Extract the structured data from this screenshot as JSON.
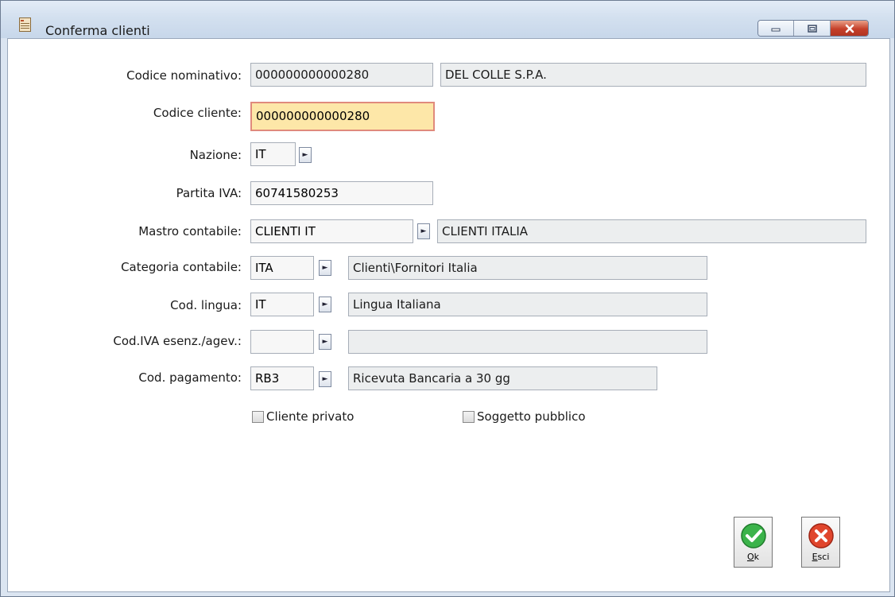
{
  "window": {
    "title": "Conferma clienti"
  },
  "form": {
    "codice_nominativo": {
      "label": "Codice nominativo:",
      "code": "000000000000280",
      "description": "DEL COLLE S.P.A."
    },
    "codice_cliente": {
      "label": "Codice cliente:",
      "value": "000000000000280"
    },
    "nazione": {
      "label": "Nazione:",
      "value": "IT"
    },
    "partita_iva": {
      "label": "Partita IVA:",
      "value": "60741580253"
    },
    "mastro_contabile": {
      "label": "Mastro contabile:",
      "code": "CLIENTI IT",
      "description": "CLIENTI ITALIA"
    },
    "categoria_contabile": {
      "label": "Categoria contabile:",
      "code": "ITA",
      "description": "Clienti\\Fornitori Italia"
    },
    "cod_lingua": {
      "label": "Cod. lingua:",
      "code": "IT",
      "description": "Lingua Italiana"
    },
    "cod_iva": {
      "label": "Cod.IVA esenz./agev.:",
      "code": "",
      "description": ""
    },
    "cod_pagamento": {
      "label": "Cod. pagamento:",
      "code": "RB3",
      "description": "Ricevuta Bancaria a 30 gg"
    },
    "cliente_privato": {
      "label": "Cliente privato",
      "checked": false
    },
    "soggetto_pubblico": {
      "label": "Soggetto pubblico",
      "checked": false
    }
  },
  "buttons": {
    "ok": {
      "label_mnemonic": "O",
      "label_rest": "k"
    },
    "esci": {
      "label_mnemonic": "E",
      "label_rest": "sci"
    }
  },
  "colors": {
    "highlight_field": "#fde7a8",
    "ok_icon": "#3bb34a",
    "esci_icon": "#e0452c"
  }
}
